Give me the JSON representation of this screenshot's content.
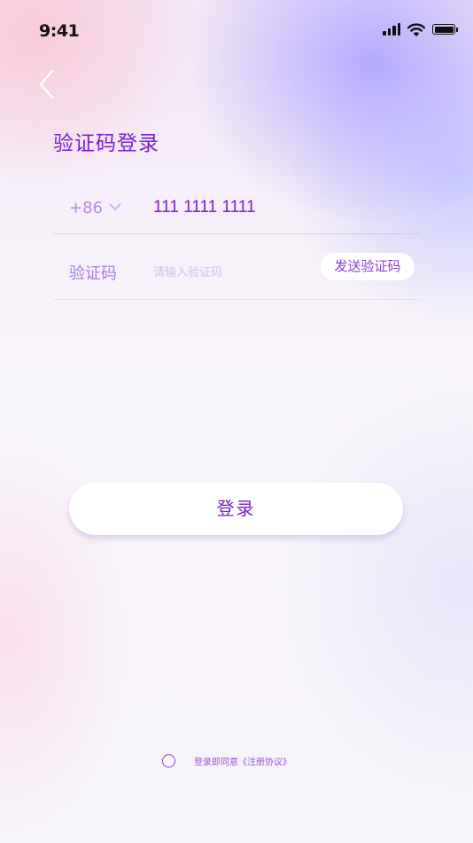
{
  "status_bar": {
    "time": "9:41"
  },
  "icons": {
    "back": "chevron-left-icon",
    "dropdown": "chevron-down-icon",
    "signal": "signal-icon",
    "wifi": "wifi-icon",
    "battery": "battery-icon"
  },
  "page": {
    "title": "验证码登录"
  },
  "phone": {
    "country_code": "+86",
    "number": "111 1111 1111"
  },
  "verification": {
    "label": "验证码",
    "placeholder": "请输入验证码",
    "value": "",
    "send_button": "发送验证码"
  },
  "login": {
    "button_label": "登录"
  },
  "agreement": {
    "text": "登录即同意",
    "link": "《注册协议》",
    "checked": false
  },
  "colors": {
    "primary": "#7a1fc9",
    "muted": "#b48ce6",
    "placeholder": "#d2bdf0"
  }
}
